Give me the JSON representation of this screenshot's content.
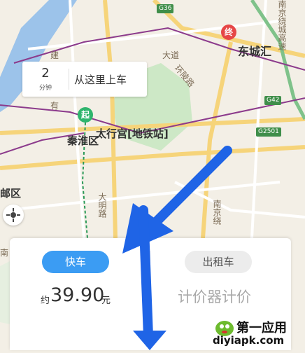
{
  "map": {
    "labels": {
      "dongchenghui": "东城汇",
      "taixinggong": "太行宫[地铁站]",
      "qinhuai": "秦淮区",
      "youqu": "邮区",
      "damingroad": "大明路",
      "huanling": "环陵路",
      "nanjingraocheng": "南京绕城高速",
      "nanjingrao2": "南京绕",
      "jian": "建",
      "dadao": "大道",
      "nan": "南",
      "you": "有"
    },
    "shields": {
      "g36": "G36",
      "g42": "G42",
      "g2501": "G2501"
    },
    "pins": {
      "start": "起",
      "end": "终"
    }
  },
  "eta": {
    "minutes": "2",
    "unit": "分钟",
    "pickup_text": "从这里上车"
  },
  "ride_card": {
    "express_label": "快车",
    "taxi_label": "出租车",
    "price_prefix": "约",
    "price_value": "39.90",
    "price_unit": "元",
    "meter_text": "计价器计价"
  },
  "watermark": {
    "title": "第一应用",
    "url": "diyiapk.com"
  },
  "colors": {
    "express": "#3b9cf3",
    "arrow": "#1f64e6",
    "start": "#2fb56d",
    "end": "#e64646"
  }
}
